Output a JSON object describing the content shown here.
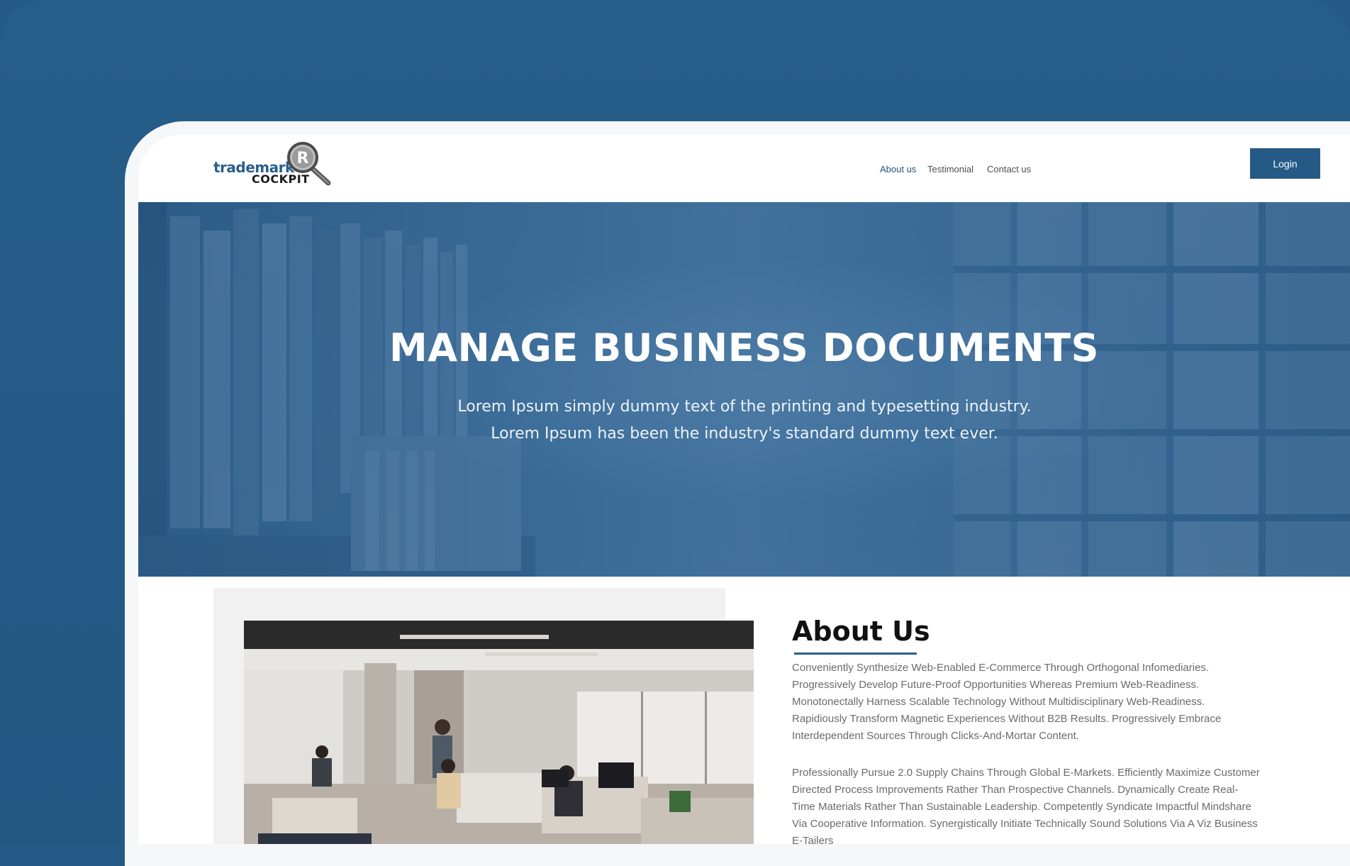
{
  "logo": {
    "line1": "trademark",
    "line2": "COCKPIT",
    "badge": "R"
  },
  "nav": {
    "items": [
      {
        "label": "About us",
        "active": true
      },
      {
        "label": "Testimonial",
        "active": false
      },
      {
        "label": "Contact us",
        "active": false
      }
    ],
    "login_label": "Login"
  },
  "hero": {
    "title": "MANAGE BUSINESS DOCUMENTS",
    "subtitle": "Lorem Ipsum simply dummy text of the printing and typesetting industry. Lorem Ipsum has been the industry's  standard dummy text ever."
  },
  "about": {
    "title": "About Us",
    "paragraph1": "Conveniently Synthesize Web-Enabled E-Commerce Through Orthogonal Infomediaries. Progressively Develop Future-Proof Opportunities Whereas Premium Web-Readiness. Monotonectally Harness Scalable Technology Without Multidisciplinary Web-Readiness. Rapidiously Transform Magnetic Experiences Without B2B Results. Progressively Embrace Interdependent Sources Through Clicks-And-Mortar Content.",
    "paragraph2": "Professionally Pursue 2.0 Supply Chains Through Global E-Markets. Efficiently Maximize Customer Directed Process Improvements Rather Than Prospective Channels. Dynamically Create Real-Time Materials Rather Than Sustainable Leadership. Competently Syndicate Impactful Mindshare Via Cooperative Information. Synergistically Initiate Technically Sound Solutions Via A Viz Business E-Tailers"
  },
  "colors": {
    "brand": "#255a86",
    "background": "#255a86",
    "text_muted": "#6b6b6b"
  }
}
